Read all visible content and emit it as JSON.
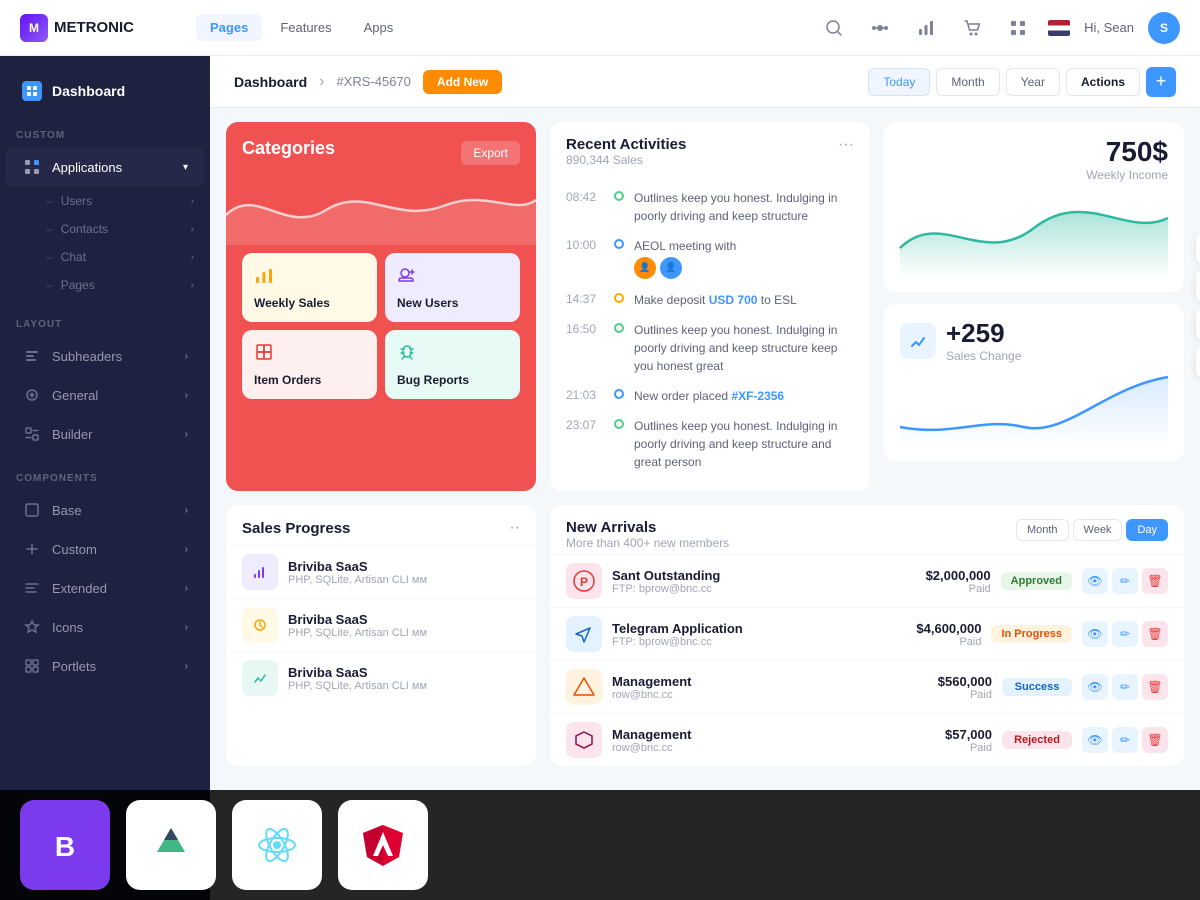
{
  "app": {
    "name": "METRONIC",
    "logo_letter": "M"
  },
  "topnav": {
    "links": [
      "Pages",
      "Features",
      "Apps"
    ],
    "active_link": "Pages",
    "user_greeting": "Hi, Sean",
    "avatar_letter": "S"
  },
  "subheader": {
    "breadcrumb": "Dashboard",
    "ref_id": "#XRS-45670",
    "add_new": "Add New",
    "time_buttons": [
      "Today",
      "Month",
      "Year"
    ],
    "active_time": "Today",
    "actions_label": "Actions"
  },
  "sidebar": {
    "dashboard_label": "Dashboard",
    "custom_label": "CUSTOM",
    "applications_label": "Applications",
    "users_label": "Users",
    "contacts_label": "Contacts",
    "chat_label": "Chat",
    "pages_label": "Pages",
    "layout_label": "LAYOUT",
    "subheaders_label": "Subheaders",
    "general_label": "General",
    "builder_label": "Builder",
    "components_label": "COMPONENTS",
    "base_label": "Base",
    "custom2_label": "Custom",
    "extended_label": "Extended",
    "icons_label": "Icons",
    "portlets_label": "Portlets"
  },
  "categories_card": {
    "title": "Categories",
    "export_label": "Export",
    "tiles": [
      {
        "label": "Weekly Sales",
        "color": "yellow"
      },
      {
        "label": "New Users",
        "color": "purple"
      },
      {
        "label": "Item Orders",
        "color": "pink"
      },
      {
        "label": "Bug Reports",
        "color": "teal"
      }
    ]
  },
  "recent_activities": {
    "title": "Recent Activities",
    "subtitle": "890,344 Sales",
    "items": [
      {
        "time": "08:42",
        "text": "Outlines keep you honest. Indulging in poorly driving and keep structure",
        "dot_color": "green"
      },
      {
        "time": "10:00",
        "text": "AEOL meeting with",
        "dot_color": "blue",
        "has_avatars": true
      },
      {
        "time": "14:37",
        "text": "Make deposit USD 700 to ESL",
        "dot_color": "orange",
        "highlight": "USD 700"
      },
      {
        "time": "16:50",
        "text": "Outlines keep you honest. Indulging in poorly driving and keep structure keep you honest great",
        "dot_color": "green"
      },
      {
        "time": "21:03",
        "text": "New order placed #XF-2356",
        "dot_color": "blue",
        "highlight": "#XF-2356"
      },
      {
        "time": "23:07",
        "text": "Outlines keep you honest. Indulging in poorly driving and keep structure and great person",
        "dot_color": "green"
      }
    ]
  },
  "weekly_income": {
    "amount": "750$",
    "label": "Weekly Income"
  },
  "sales_change": {
    "amount": "+259",
    "label": "Sales Change"
  },
  "sales_progress": {
    "title": "Sales Progress",
    "items": [
      {
        "name": "Briviba SaaS",
        "sub": "PHP, SQLite, Artisan CLI мм",
        "icon_color": "purple"
      },
      {
        "name": "Briviba SaaS",
        "sub": "PHP, SQLite, Artisan CLI мм",
        "icon_color": "yellow"
      },
      {
        "name": "Briviba SaaS",
        "sub": "PHP, SQLite, Artisan CLI мм",
        "icon_color": "teal"
      }
    ]
  },
  "new_arrivals": {
    "title": "New Arrivals",
    "subtitle": "More than 400+ new members",
    "time_buttons": [
      "Month",
      "Week",
      "Day"
    ],
    "active_time": "Day",
    "rows": [
      {
        "name": "Sant Outstanding",
        "ftp": "FTP: bprow@bnc.cc",
        "amount": "$2,000,000",
        "paid": "Paid",
        "badge": "Approved",
        "badge_type": "approved",
        "icon": "🅿",
        "icon_bg": "#fce4ec",
        "icon_color": "#e53935"
      },
      {
        "name": "Telegram Application",
        "ftp": "FTP: bprow@bnc.cc",
        "amount": "$4,600,000",
        "paid": "Paid",
        "badge": "In Progress",
        "badge_type": "inprogress",
        "icon": "✈",
        "icon_bg": "#e3f2fd",
        "icon_color": "#1565c0"
      },
      {
        "name": "Management",
        "ftp": "row@bnc.cc",
        "amount": "$560,000",
        "paid": "Paid",
        "badge": "Success",
        "badge_type": "success",
        "icon": "🔺",
        "icon_bg": "#fff8e1",
        "icon_color": "#e65100"
      },
      {
        "name": "Management",
        "ftp": "row@bnc.cc",
        "amount": "$57,000",
        "paid": "Paid",
        "badge": "Rejected",
        "badge_type": "rejected",
        "icon": "⬡",
        "icon_bg": "#fce4ec",
        "icon_color": "#880e4f"
      }
    ]
  },
  "frameworks": [
    {
      "name": "Bootstrap",
      "letter": "B",
      "bg": "#7c3aed",
      "color": "#fff"
    },
    {
      "name": "Vue",
      "symbol": "V",
      "bg": "#fff",
      "color": "#41b883"
    },
    {
      "name": "React",
      "symbol": "⚛",
      "bg": "#fff",
      "color": "#61dafb"
    },
    {
      "name": "Angular",
      "symbol": "A",
      "bg": "#fff",
      "color": "#dd0031"
    }
  ]
}
